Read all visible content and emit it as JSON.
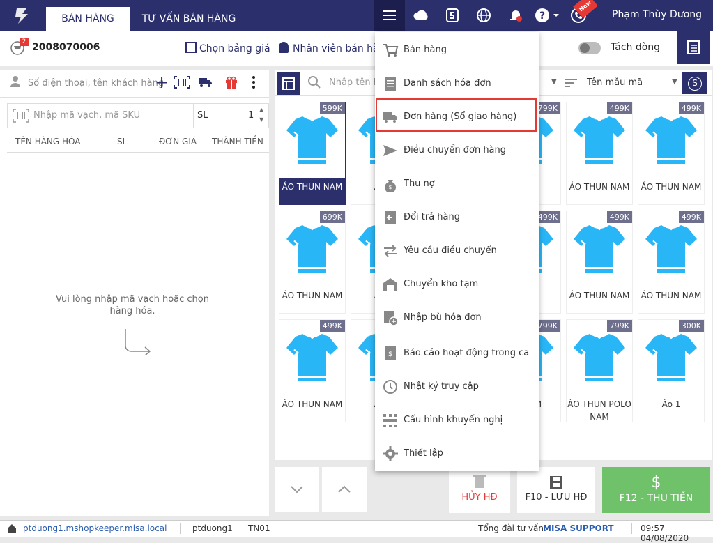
{
  "header": {
    "tabs": [
      {
        "label": "BÁN HÀNG"
      },
      {
        "label": "TƯ VẤN BÁN HÀNG"
      }
    ],
    "user_name": "Phạm Thùy Dương",
    "new_badge": "New"
  },
  "order_bar": {
    "cart_count": "2",
    "order_number": "2008070006",
    "price_list_label": "Chọn bảng giá",
    "salesperson_label": "Nhân viên bán hàn",
    "split_line_label": "Tách dòng"
  },
  "customer": {
    "placeholder": "Số điện thoại, tên khách hàng"
  },
  "barcode": {
    "placeholder": "Nhập mã vạch, mã SKU",
    "qty_label": "SL",
    "qty_value": "1"
  },
  "cart_table": {
    "columns": [
      "TÊN HÀNG HÓA",
      "SL",
      "ĐƠN GIÁ",
      "THÀNH TIỀN"
    ],
    "empty_message_line1": "Vui lòng nhập mã vạch hoặc chọn",
    "empty_message_line2": "hàng hóa."
  },
  "product_search": {
    "placeholder": "Nhập tên h",
    "template_label": "Tên mẫu mã",
    "currency_symbol": "S"
  },
  "products": [
    {
      "name": "ÁO THUN NAM",
      "price": "599K",
      "selected": true
    },
    {
      "name": "ÁO T",
      "price": ""
    },
    {
      "name": "",
      "price": ""
    },
    {
      "name": "NAM",
      "price": "799K"
    },
    {
      "name": "ÁO THUN NAM",
      "price": "499K"
    },
    {
      "name": "ÁO THUN NAM",
      "price": "499K"
    },
    {
      "name": "ÁO THUN NAM",
      "price": "699K"
    },
    {
      "name": "ÁO T",
      "price": ""
    },
    {
      "name": "",
      "price": ""
    },
    {
      "name": "NAM",
      "price": "499K"
    },
    {
      "name": "ÁO THUN NAM",
      "price": "499K"
    },
    {
      "name": "ÁO THUN NAM",
      "price": "499K"
    },
    {
      "name": "ÁO THUN NAM",
      "price": "499K"
    },
    {
      "name": "ÁO T",
      "price": ""
    },
    {
      "name": "",
      "price": ""
    },
    {
      "name": "UN AM",
      "price": "799K"
    },
    {
      "name": "ÁO THUN POLO NAM",
      "price": "799K"
    },
    {
      "name": "Áo 1",
      "price": "300K"
    }
  ],
  "menu": {
    "items": [
      {
        "label": "Bán hàng",
        "icon": "cart-icon"
      },
      {
        "label": "Danh sách hóa đơn",
        "icon": "document-list-icon"
      },
      {
        "label": "Đơn hàng (Sổ giao hàng)",
        "icon": "delivery-truck-icon"
      },
      {
        "label": "Điều chuyển đơn hàng",
        "icon": "send-icon"
      },
      {
        "label": "Thu nợ",
        "icon": "money-bag-icon"
      },
      {
        "label": "Đổi trả hàng",
        "icon": "return-icon"
      },
      {
        "label": "Yêu cầu điều chuyển",
        "icon": "transfer-arrows-icon"
      },
      {
        "label": "Chuyển kho tạm",
        "icon": "warehouse-icon"
      },
      {
        "label": "Nhập bù hóa đơn",
        "icon": "add-document-icon"
      },
      {
        "label": "Báo cáo hoạt động trong ca",
        "icon": "report-icon"
      },
      {
        "label": "Nhật ký truy cập",
        "icon": "history-icon"
      },
      {
        "label": "Cấu hình khuyến nghị",
        "icon": "config-icon"
      },
      {
        "label": "Thiết lập",
        "icon": "gear-icon"
      }
    ],
    "highlighted_index": 2
  },
  "actions": {
    "cancel_label": "HỦY HĐ",
    "save_label": "F10 - LƯU HĐ",
    "pay_label": "F12 - THU TIỀN",
    "pay_icon": "$"
  },
  "status_bar": {
    "url": "ptduong1.mshopkeeper.misa.local",
    "user": "ptduong1",
    "branch": "TN01",
    "support_label": "Tổng đài tư vấn:",
    "support_name": "MISA SUPPORT",
    "datetime": "09:57 04/08/2020"
  },
  "colors": {
    "primary": "#2b2f6c",
    "accent": "#e53935",
    "pay": "#6fc26a",
    "shirt": "#29b6f6"
  }
}
